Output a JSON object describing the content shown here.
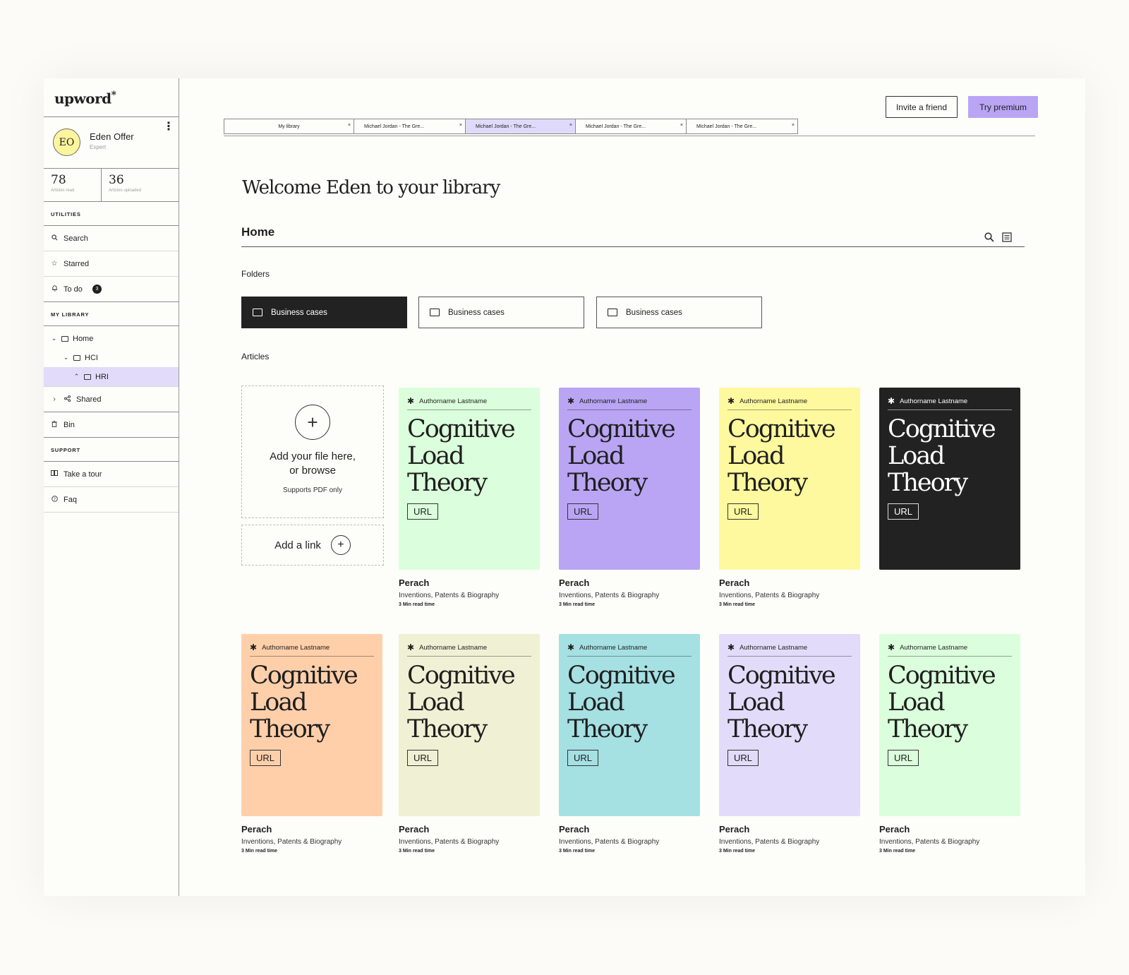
{
  "app": {
    "logo": "upword",
    "logo_mark": "*"
  },
  "profile": {
    "initials": "EO",
    "name": "Eden Offer",
    "role": "Expert",
    "stats": [
      {
        "value": "78",
        "label": "Articles read"
      },
      {
        "value": "36",
        "label": "Articles uploaded"
      }
    ]
  },
  "sidebar": {
    "utilities_header": "UTILITIES",
    "search": "Search",
    "starred": "Starred",
    "todo": "To do",
    "todo_count": "3",
    "library_header": "MY LIBRARY",
    "tree": [
      {
        "label": "Home",
        "indent": 0,
        "chevron": "⌄",
        "selected": false
      },
      {
        "label": "HCI",
        "indent": 1,
        "chevron": "⌄",
        "selected": false
      },
      {
        "label": "HRI",
        "indent": 2,
        "chevron": "⌃",
        "selected": true
      }
    ],
    "shared": "Shared",
    "bin": "Bin",
    "support_header": "SUPPORT",
    "tour": "Take a tour",
    "faq": "Faq"
  },
  "header": {
    "invite": "Invite a friend",
    "premium": "Try premium",
    "premium_color": "#b9a5f4"
  },
  "tabs": [
    {
      "label": "My library",
      "active": false
    },
    {
      "label": "Michael Jordan - The Gre...",
      "active": false
    },
    {
      "label": "Michael Jordan - The Gre...",
      "active": true
    },
    {
      "label": "Michael Jordan - The Gre...",
      "active": false
    },
    {
      "label": "Michael Jordan - The Gre...",
      "active": false
    }
  ],
  "main": {
    "welcome": "Welcome Eden to your library",
    "home_title": "Home",
    "folders_label": "Folders",
    "folders": [
      {
        "label": "Business cases",
        "dark": true
      },
      {
        "label": "Business cases",
        "dark": false
      },
      {
        "label": "Business cases",
        "dark": false
      }
    ],
    "articles_label": "Articles",
    "upload": {
      "title": "Add your file here, or browse",
      "subtitle": "Supports PDF only",
      "add_link": "Add a link"
    },
    "articles": [
      {
        "author": "Authorname Lastname",
        "title": "Cognitive\nLoad\nTheory",
        "tag": "URL",
        "color": "#dbffdc",
        "dark": false,
        "name": "Perach",
        "category": "Inventions, Patents & Biography",
        "time": "3 Min read time"
      },
      {
        "author": "Authorname Lastname",
        "title": "Cognitive\nLoad\nTheory",
        "tag": "URL",
        "color": "#b9a5f4",
        "dark": false,
        "name": "Perach",
        "category": "Inventions, Patents & Biography",
        "time": "3 Min read time"
      },
      {
        "author": "Authorname Lastname",
        "title": "Cognitive\nLoad\nTheory",
        "tag": "URL",
        "color": "#fef99e",
        "dark": false,
        "name": "Perach",
        "category": "Inventions, Patents & Biography",
        "time": "3 Min read time"
      },
      {
        "author": "Authorname Lastname",
        "title": "Cognitive\nLoad\nTheory",
        "tag": "URL",
        "color": "#222222",
        "dark": true,
        "name": "",
        "category": "",
        "time": ""
      },
      {
        "author": "Authorname Lastname",
        "title": "Cognitive\nLoad\nTheory",
        "tag": "URL",
        "color": "#ffcfaa",
        "dark": false,
        "name": "Perach",
        "category": "Inventions, Patents & Biography",
        "time": "3 Min read time"
      },
      {
        "author": "Authorname Lastname",
        "title": "Cognitive\nLoad\nTheory",
        "tag": "URL",
        "color": "#f0f0d4",
        "dark": false,
        "name": "Perach",
        "category": "Inventions, Patents & Biography",
        "time": "3 Min read time"
      },
      {
        "author": "Authorname Lastname",
        "title": "Cognitive\nLoad\nTheory",
        "tag": "URL",
        "color": "#a5e0e3",
        "dark": false,
        "name": "Perach",
        "category": "Inventions, Patents & Biography",
        "time": "3 Min read time"
      },
      {
        "author": "Authorname Lastname",
        "title": "Cognitive\nLoad\nTheory",
        "tag": "URL",
        "color": "#e2dcfa",
        "dark": false,
        "name": "Perach",
        "category": "Inventions, Patents & Biography",
        "time": "3 Min read time"
      },
      {
        "author": "Authorname Lastname",
        "title": "Cognitive\nLoad\nTheory",
        "tag": "URL",
        "color": "#dbffdc",
        "dark": false,
        "name": "Perach",
        "category": "Inventions, Patents & Biography",
        "time": "3 Min read time"
      }
    ]
  }
}
